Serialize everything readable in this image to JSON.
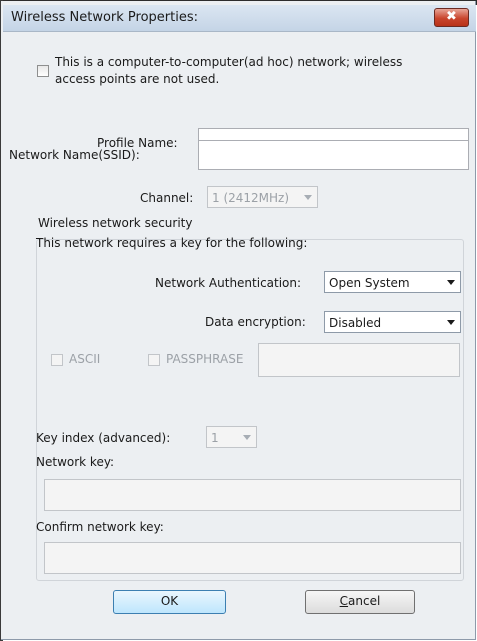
{
  "window": {
    "title": "Wireless Network Properties:",
    "close_glyph": "✖"
  },
  "adhoc": {
    "checked": false,
    "label_line1": "This is a computer-to-computer(ad hoc) network; wireless",
    "label_line2": "access points are not used."
  },
  "profile": {
    "label": "Profile Name:",
    "value": ""
  },
  "ssid": {
    "label": "Network Name(SSID):",
    "value": ""
  },
  "channel": {
    "label": "Channel:",
    "value": "1 (2412MHz)",
    "enabled": false
  },
  "security": {
    "group_label": "Wireless network security",
    "intro": "This network requires a key for the following:",
    "auth_label": "Network Authentication:",
    "auth_value": "Open System",
    "enc_label": "Data encryption:",
    "enc_value": "Disabled",
    "ascii_label": "ASCII",
    "passphrase_label": "PASSPHRASE",
    "passphrase_value": "",
    "key_index_label": "Key index (advanced):",
    "key_index_value": "1",
    "network_key_label": "Network key:",
    "network_key_value": "",
    "confirm_key_label": "Confirm network key:",
    "confirm_key_value": ""
  },
  "buttons": {
    "ok": "OK",
    "cancel_mnemonic": "C",
    "cancel_rest": "ancel"
  },
  "colors": {
    "window_bg": "#eceff2",
    "default_button_border": "#3c7fb1",
    "close_button": "#c9452d",
    "disabled_text": "#9ca1a7"
  }
}
